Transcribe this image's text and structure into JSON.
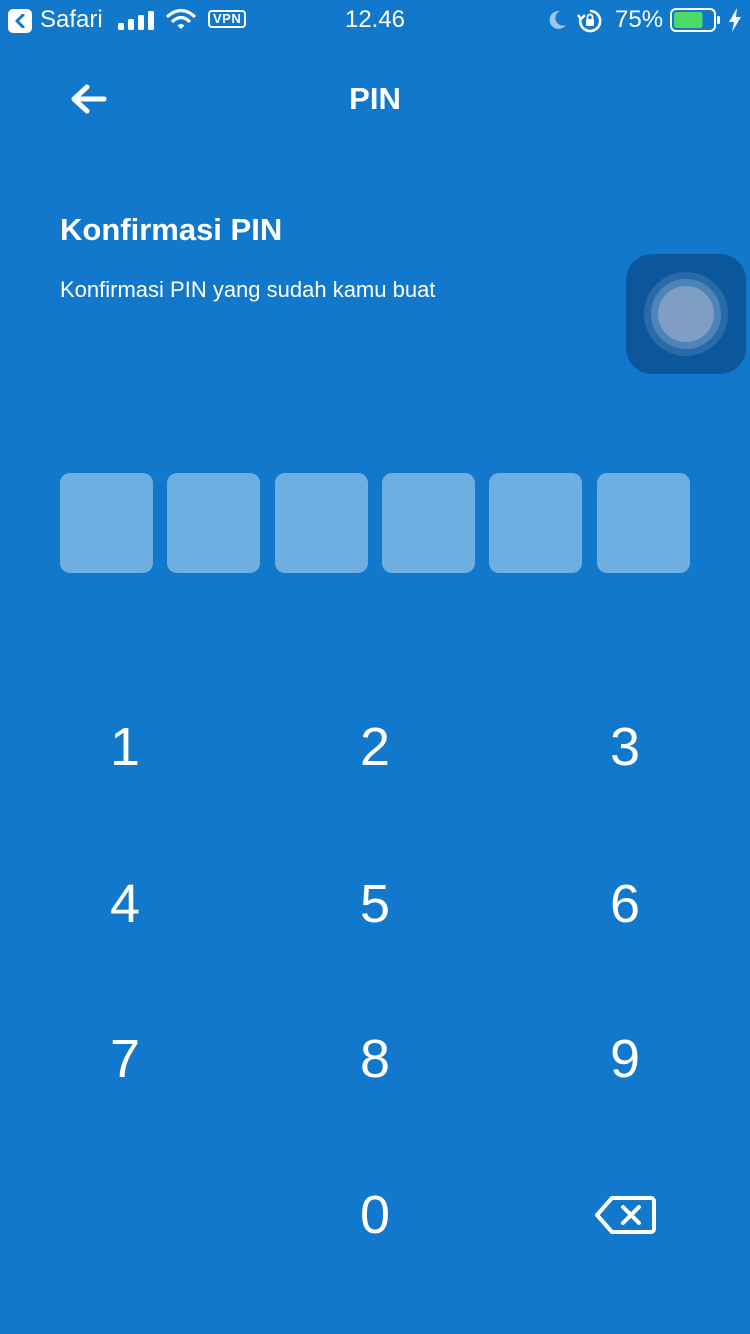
{
  "status_bar": {
    "app_name": "Safari",
    "vpn": "VPN",
    "time": "12.46",
    "battery_percent": "75%",
    "battery_color": "#4cd964"
  },
  "header": {
    "title": "PIN",
    "back_icon": "arrow-left-icon"
  },
  "content": {
    "heading": "Konfirmasi PIN",
    "subtitle": "Konfirmasi PIN yang sudah kamu buat"
  },
  "pin": {
    "length": 6,
    "filled": 0
  },
  "keypad": {
    "keys": [
      "1",
      "2",
      "3",
      "4",
      "5",
      "6",
      "7",
      "8",
      "9",
      "",
      "0",
      "backspace"
    ],
    "delete_icon": "backspace-icon"
  },
  "colors": {
    "background": "#1178cc",
    "pin_box": "#6eaee0",
    "text": "#ffffff"
  }
}
